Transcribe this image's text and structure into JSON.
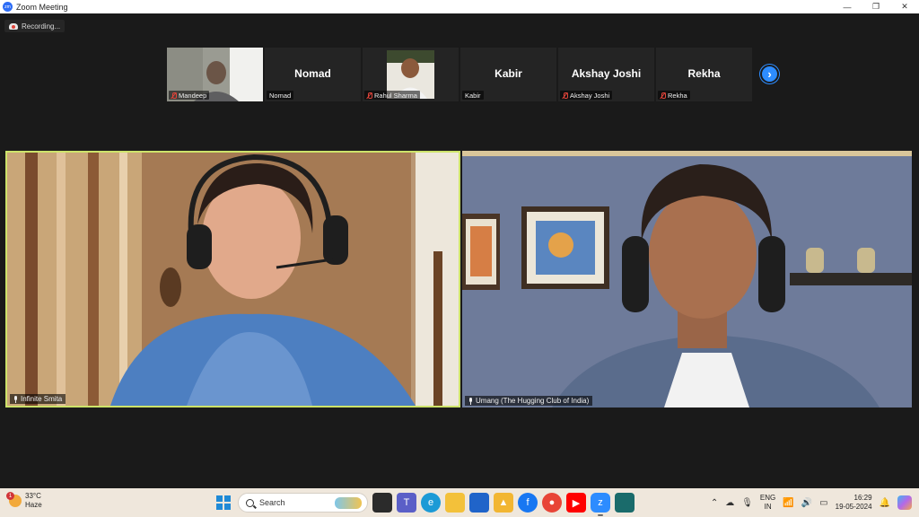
{
  "window": {
    "title": "Zoom Meeting",
    "controls": {
      "minimize": "—",
      "restore": "❐",
      "close": "✕"
    }
  },
  "recording": {
    "label": "Recording..."
  },
  "participants_strip": [
    {
      "name": "Mandeep",
      "has_video": true,
      "muted": true
    },
    {
      "name": "Nomad",
      "has_video": false,
      "muted": false
    },
    {
      "name": "Rahul Sharma",
      "has_video": true,
      "muted": true
    },
    {
      "name": "Kabir",
      "has_video": false,
      "muted": false
    },
    {
      "name": "Akshay Joshi",
      "has_video": false,
      "muted": true
    },
    {
      "name": "Rekha",
      "has_video": false,
      "muted": true
    }
  ],
  "next_page_glyph": "›",
  "speakers": {
    "left": {
      "name": "Infinite Smita"
    },
    "right": {
      "name": "Umang (The Hugging Club of India)"
    }
  },
  "taskbar": {
    "weather": {
      "temp": "33°C",
      "condition": "Haze",
      "badge": "1"
    },
    "search_placeholder": "Search",
    "language": {
      "line1": "ENG",
      "line2": "IN"
    },
    "clock": {
      "time": "16:29",
      "date": "19-05-2024"
    }
  },
  "colors": {
    "active_speaker_border": "#cde36a",
    "zoom_blue": "#2d8cff",
    "muted_red": "#e0443a",
    "taskbar_bg": "#efe7dc"
  }
}
